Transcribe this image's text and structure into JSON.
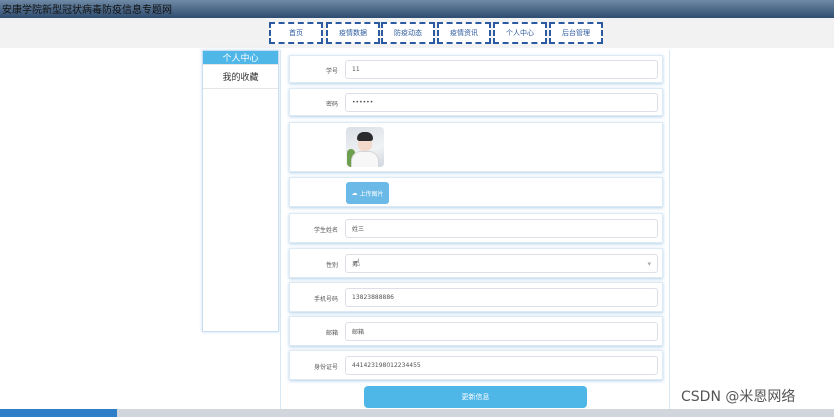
{
  "site": {
    "title": "安康学院新型冠状病毒防疫信息专题网"
  },
  "nav": [
    "首页",
    "疫情数据",
    "防疫动态",
    "疫情资讯",
    "个人中心",
    "后台管理"
  ],
  "sidebar": {
    "items": [
      "个人中心",
      "我的收藏"
    ]
  },
  "form": {
    "username_label": "学号",
    "username_value": "11",
    "password_label": "密码",
    "password_value": "••••••",
    "upload_label": "上传图片",
    "name_label": "学生姓名",
    "name_value": "姓三",
    "gender_label": "性别",
    "gender_value": "男",
    "phone_label": "手机号码",
    "phone_value": "13823888886",
    "email_label": "邮箱",
    "email_value": "邮箱",
    "id_label": "身份证号",
    "id_value": "441423198012234455",
    "submit_label": "更新信息"
  },
  "watermark": "CSDN @米恩网络"
}
